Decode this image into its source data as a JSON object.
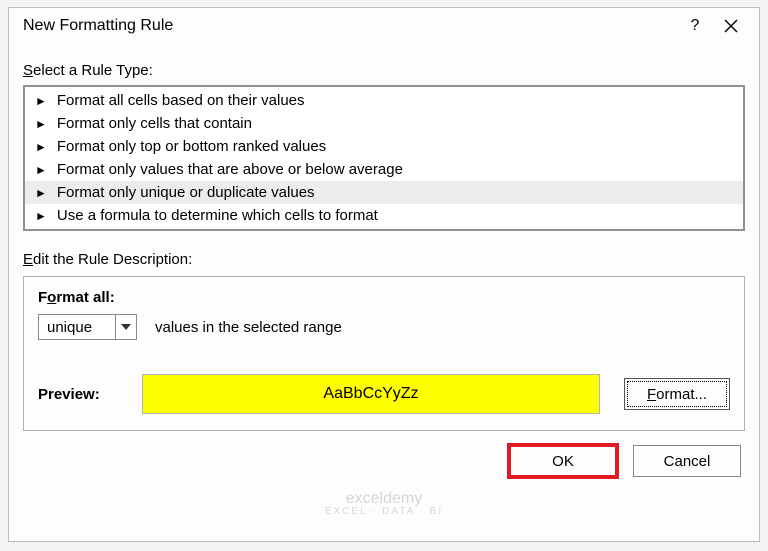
{
  "title": "New Formatting Rule",
  "help_char": "?",
  "select_label": "Select a Rule Type:",
  "rules": [
    "Format all cells based on their values",
    "Format only cells that contain",
    "Format only top or bottom ranked values",
    "Format only values that are above or below average",
    "Format only unique or duplicate values",
    "Use a formula to determine which cells to format"
  ],
  "selected_rule_index": 4,
  "edit_label": "Edit the Rule Description:",
  "format_all_html": "F<span class='ul'>o</span>rmat all:",
  "combo_value": "unique",
  "combo_suffix": "values in the selected range",
  "preview_label": "Preview:",
  "preview_text": "AaBbCcYyZz",
  "format_btn_html": "<span class='ul'>F</span>ormat...",
  "ok_label": "OK",
  "cancel_label": "Cancel",
  "watermark": "exceldemy",
  "watermark_sub": "EXCEL · DATA · BI"
}
